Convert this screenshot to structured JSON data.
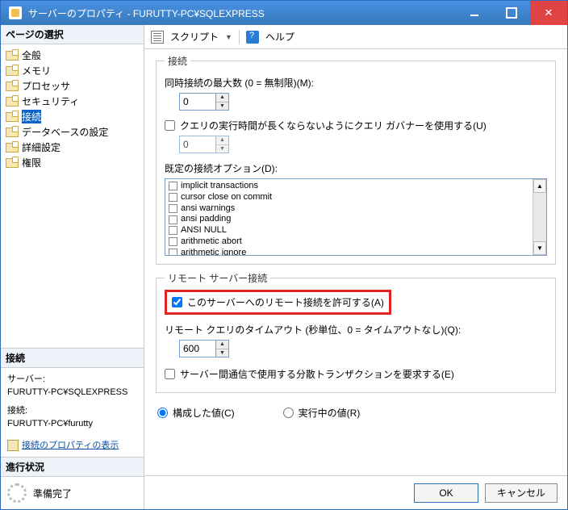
{
  "window": {
    "title": "サーバーのプロパティ - FURUTTY-PC¥SQLEXPRESS"
  },
  "toolbar": {
    "script": "スクリプト",
    "help": "ヘルプ"
  },
  "sidebar": {
    "pages_header": "ページの選択",
    "items": [
      {
        "label": "全般"
      },
      {
        "label": "メモリ"
      },
      {
        "label": "プロセッサ"
      },
      {
        "label": "セキュリティ"
      },
      {
        "label": "接続"
      },
      {
        "label": "データベースの設定"
      },
      {
        "label": "詳細設定"
      },
      {
        "label": "権限"
      }
    ],
    "conn_header": "接続",
    "server_label": "サーバー:",
    "server_value": "FURUTTY-PC¥SQLEXPRESS",
    "conn_label": "接続:",
    "conn_value": "FURUTTY-PC¥furutty",
    "view_props": "接続のプロパティの表示",
    "progress_header": "進行状況",
    "progress_value": "準備完了"
  },
  "connections": {
    "legend": "接続",
    "max_conn_label": "同時接続の最大数 (0 = 無制限)(M):",
    "max_conn_value": "0",
    "governor_label": "クエリの実行時間が長くならないようにクエリ ガバナーを使用する(U)",
    "governor_value": "0",
    "default_opts_label": "既定の接続オプション(D):",
    "options": [
      "implicit transactions",
      "cursor close on commit",
      "ansi warnings",
      "ansi padding",
      "ANSI NULL",
      "arithmetic abort",
      "arithmetic ignore"
    ]
  },
  "remote": {
    "legend": "リモート サーバー接続",
    "allow_label": "このサーバーへのリモート接続を許可する(A)",
    "timeout_label": "リモート クエリのタイムアウト (秒単位、0 = タイムアウトなし)(Q):",
    "timeout_value": "600",
    "dtc_label": "サーバー間通信で使用する分散トランザクションを要求する(E)"
  },
  "radios": {
    "configured": "構成した値(C)",
    "running": "実行中の値(R)"
  },
  "buttons": {
    "ok": "OK",
    "cancel": "キャンセル"
  }
}
